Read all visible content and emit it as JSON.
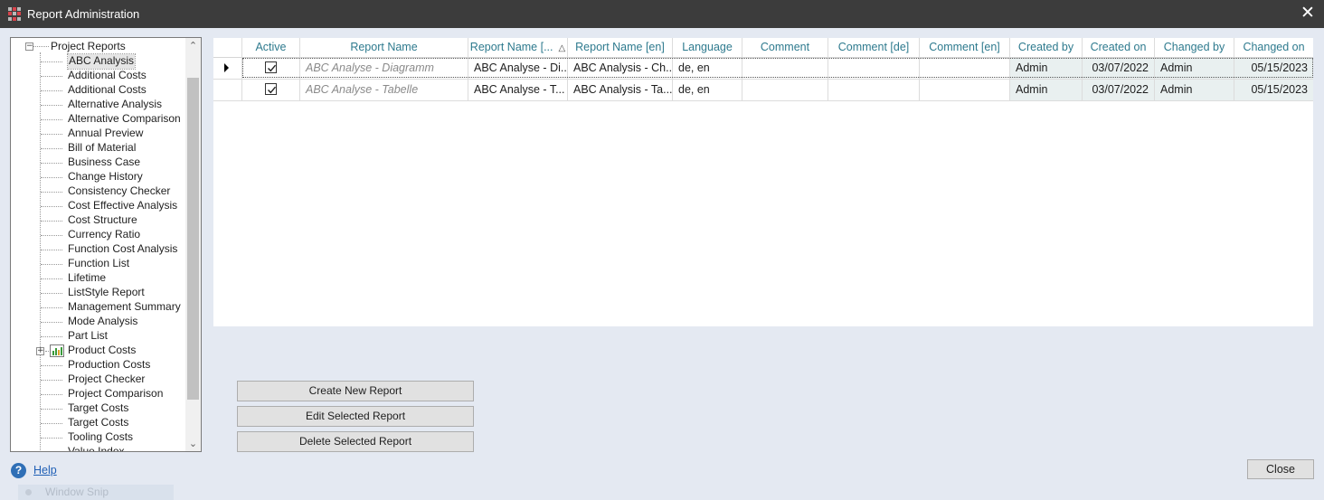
{
  "window": {
    "title": "Report Administration",
    "close_glyph": "✕"
  },
  "tree": {
    "root_label": "Project Reports",
    "selected_index": 0,
    "items": [
      "ABC Analysis",
      "Additional Costs",
      "Additional Costs",
      "Alternative Analysis",
      "Alternative Comparison",
      "Annual Preview",
      "Bill of Material",
      "Business Case",
      "Change History",
      "Consistency Checker",
      "Cost Effective Analysis",
      "Cost Structure",
      "Currency Ratio",
      "Function Cost Analysis",
      "Function List",
      "Lifetime",
      "ListStyle Report",
      "Management Summary",
      "Mode Analysis",
      "Part List",
      "Product Costs",
      "Production Costs",
      "Project Checker",
      "Project Comparison",
      "Target Costs",
      "Target Costs",
      "Tooling Costs",
      "Value Index"
    ],
    "expandable_item": "Product Costs",
    "icons": {
      "root_expander": "collapse-icon",
      "product_costs": "chart-icon",
      "product_costs_expander": "expand-icon"
    }
  },
  "grid": {
    "columns": [
      "Active",
      "Report Name",
      "Report Name [...",
      "Report Name [en]",
      "Language",
      "Comment",
      "Comment [de]",
      "Comment [en]",
      "Created by",
      "Created on",
      "Changed by",
      "Changed on"
    ],
    "sorted_column_glyph": "△",
    "rows": [
      {
        "active": true,
        "report_name": "ABC Analyse - Diagramm",
        "report_name_de": "ABC Analyse - Di...",
        "report_name_en": "ABC Analysis - Ch...",
        "language": "de, en",
        "comment": "",
        "comment_de": "",
        "comment_en": "",
        "created_by": "Admin",
        "created_on": "03/07/2022",
        "changed_by": "Admin",
        "changed_on": "05/15/2023"
      },
      {
        "active": true,
        "report_name": "ABC Analyse - Tabelle",
        "report_name_de": "ABC Analyse - T...",
        "report_name_en": "ABC Analysis - Ta...",
        "language": "de, en",
        "comment": "",
        "comment_de": "",
        "comment_en": "",
        "created_by": "Admin",
        "created_on": "03/07/2022",
        "changed_by": "Admin",
        "changed_on": "05/15/2023"
      }
    ]
  },
  "buttons": {
    "create": "Create New Report",
    "edit": "Edit Selected Report",
    "delete": "Delete Selected Report",
    "close": "Close"
  },
  "help": {
    "label": "Help",
    "icon_glyph": "?"
  },
  "ghost_tooltip": "Window Snip",
  "colors": {
    "titlebar": "#3c3c3c",
    "header_text": "#2e7a8e",
    "background": "#e4e9f2",
    "link": "#1f5fb5"
  }
}
